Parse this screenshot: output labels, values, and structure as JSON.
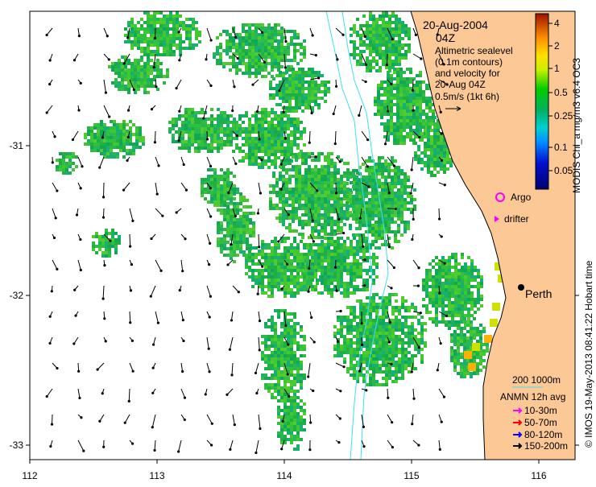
{
  "map": {
    "title_date": "20-Aug-2004",
    "title_time": "04Z",
    "description_lines": [
      "Altimetric sealevel",
      "(0.1m contours)",
      "and velocity for",
      "20-Aug 04Z",
      "0.5m/s (1kt 6h)"
    ],
    "x_ticks": [
      "112",
      "113",
      "114",
      "115",
      "116"
    ],
    "y_ticks": [
      "-31",
      "-32",
      "-33"
    ],
    "colorbar": {
      "label": "MODIS Chl_a mg/m3 v6.4 OC3",
      "ticks": [
        "4",
        "2",
        "1",
        "0.5",
        "0.25",
        "0.1",
        "0.05"
      ],
      "colors": [
        "#000080",
        "#0000ff",
        "#00c8ff",
        "#00b060",
        "#00cc00",
        "#c0f000",
        "#ffe000",
        "#ff9000",
        "#a00000"
      ]
    },
    "markers": {
      "argo": "Argo",
      "drifter": "drifter",
      "city": "Perth"
    },
    "bathymetry_legend": "200  1000m",
    "mooring_legend": {
      "title": "ANMN 12h avg",
      "items": [
        {
          "label": "10-30m",
          "color": "#ff00ff"
        },
        {
          "label": "50-70m",
          "color": "#ff0000"
        },
        {
          "label": "80-120m",
          "color": "#0000ff"
        },
        {
          "label": "150-200m",
          "color": "#000000"
        }
      ]
    },
    "credit": "© IMOS 19-May-2013 08:41:22 Hobart time",
    "land_color": "#FCC896",
    "contour_color": "#40E0F0"
  }
}
